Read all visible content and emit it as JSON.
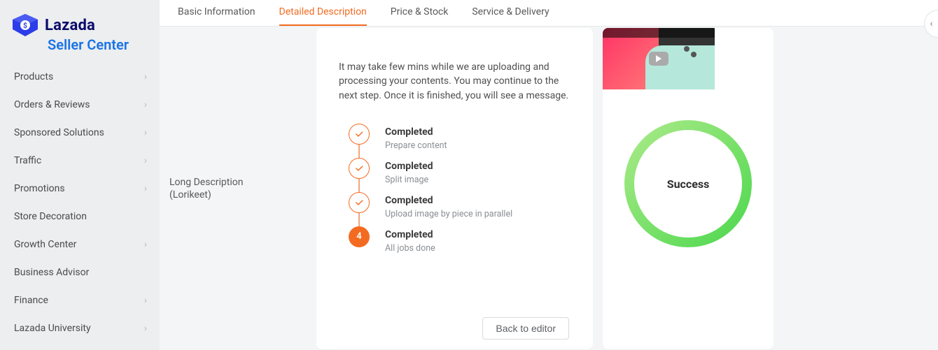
{
  "brand": {
    "name": "Lazada",
    "subtitle": "Seller Center"
  },
  "sidebar": {
    "items": [
      {
        "label": "Products",
        "expandable": true
      },
      {
        "label": "Orders & Reviews",
        "expandable": true
      },
      {
        "label": "Sponsored Solutions",
        "expandable": true
      },
      {
        "label": "Traffic",
        "expandable": true
      },
      {
        "label": "Promotions",
        "expandable": true
      },
      {
        "label": "Store Decoration",
        "expandable": false
      },
      {
        "label": "Growth Center",
        "expandable": true
      },
      {
        "label": "Business Advisor",
        "expandable": false
      },
      {
        "label": "Finance",
        "expandable": true
      },
      {
        "label": "Lazada University",
        "expandable": true
      }
    ]
  },
  "tabs": [
    {
      "label": "Basic Information"
    },
    {
      "label": "Detailed Description"
    },
    {
      "label": "Price & Stock"
    },
    {
      "label": "Service & Delivery"
    }
  ],
  "active_tab_index": 1,
  "section_label": {
    "line1": "Long Description",
    "line2": "(Lorikeet)"
  },
  "upload_panel": {
    "intro": "It may take few mins while we are uploading and processing your contents. You may continue to the next step. Once it is finished, you will see a message.",
    "steps": [
      {
        "title": "Completed",
        "sub": "Prepare content",
        "state": "check"
      },
      {
        "title": "Completed",
        "sub": "Split image",
        "state": "check"
      },
      {
        "title": "Completed",
        "sub": "Upload image by piece in parallel",
        "state": "check"
      },
      {
        "title": "Completed",
        "sub": "All jobs done",
        "state": "num",
        "num": "4"
      }
    ],
    "back_label": "Back to editor"
  },
  "right_panel": {
    "status_label": "Success",
    "ring_color": "#6fdc5f"
  }
}
